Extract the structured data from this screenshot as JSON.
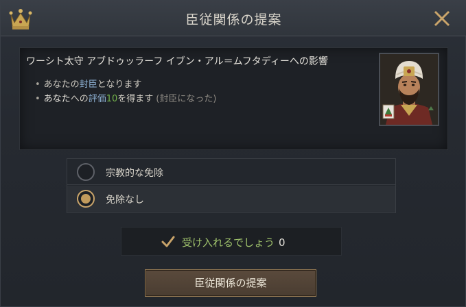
{
  "header": {
    "title": "臣従関係の提案",
    "crown_icon": "crown-icon",
    "close_icon": "close-icon"
  },
  "effects": {
    "heading": "ワーシト太守 アブドゥッラーフ イブン・アル＝ムフタディーへの影響",
    "bullet1": {
      "pre": "あなたの",
      "highlight": "封臣",
      "post": "となります"
    },
    "bullet2": {
      "pre": "あなた",
      "mid": "への",
      "highlight": "評価",
      "value": "10",
      "post": "を得ます",
      "note": "(封臣になった)"
    },
    "portrait_icon": "character-portrait"
  },
  "options": [
    {
      "label": "宗教的な免除",
      "selected": false
    },
    {
      "label": "免除なし",
      "selected": true
    }
  ],
  "acceptance": {
    "text": "受け入れるでしょう",
    "value": "0"
  },
  "propose_button": {
    "label": "臣従関係の提案"
  },
  "colors": {
    "accent_gold": "#c19a5c",
    "positive_green": "#a0c36c",
    "value_green": "#74b34b",
    "link_blue": "#8fb3d6"
  }
}
